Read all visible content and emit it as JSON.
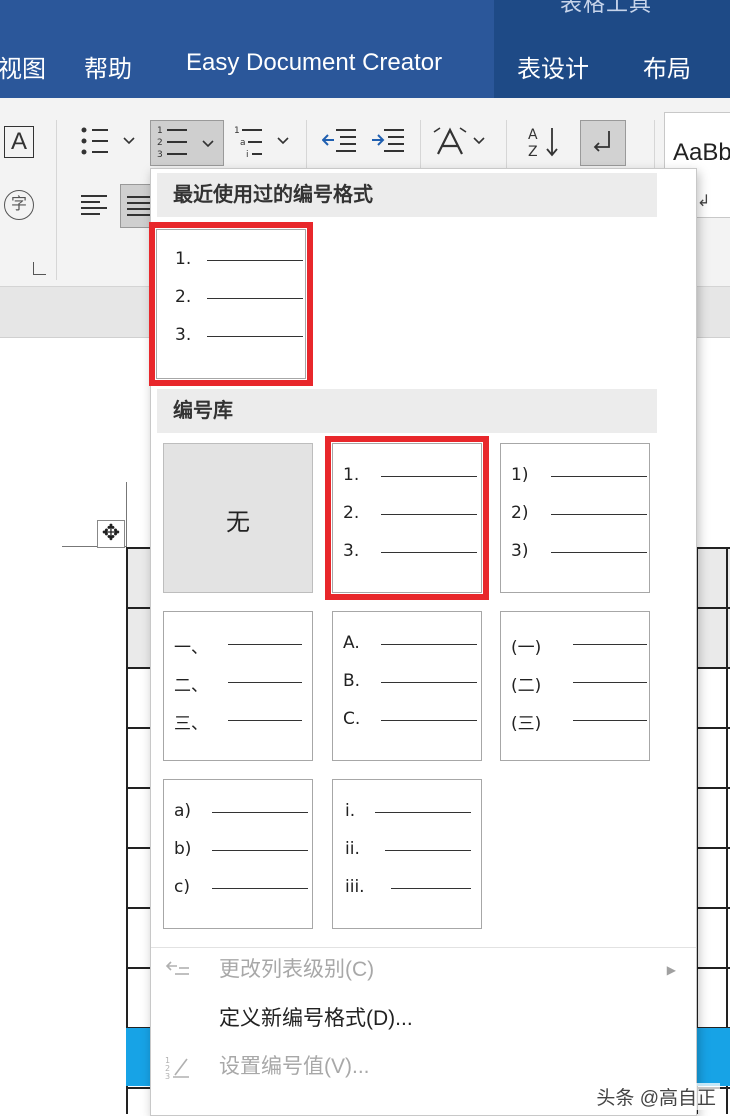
{
  "tabs": {
    "contextual_title": "表格工具",
    "view": "视图",
    "help": "帮助",
    "easy_doc": "Easy Document Creator",
    "table_design": "表设计",
    "layout": "布局"
  },
  "ribbon": {
    "style_preview": "AaBb",
    "char_A": "A",
    "char_zi": "字"
  },
  "dropdown": {
    "recent_header": "最近使用过的编号格式",
    "library_header": "编号库",
    "recent_tile": {
      "lines": [
        "1.",
        "2.",
        "3."
      ]
    },
    "none_label": "无",
    "library_tiles": [
      {
        "lines": [
          "1.",
          "2.",
          "3."
        ]
      },
      {
        "lines": [
          "1)",
          "2)",
          "3)"
        ]
      },
      {
        "lines": [
          "一、",
          "二、",
          "三、"
        ]
      },
      {
        "lines": [
          "A.",
          "B.",
          "C."
        ]
      },
      {
        "lines": [
          "(一)",
          "(二)",
          "(三)"
        ]
      },
      {
        "lines": [
          "a)",
          "b)",
          "c)"
        ]
      },
      {
        "lines": [
          "i.",
          "ii.",
          "iii."
        ]
      }
    ],
    "menu": {
      "change_level": "更改列表级别(C)",
      "define_new": "定义新编号格式(D)...",
      "set_value": "设置编号值(V)..."
    }
  },
  "watermark": "头条 @高自正",
  "colors": {
    "tab_bar": "#2b579a",
    "highlight": "#e8272b",
    "row_blue": "#17a3e6"
  }
}
